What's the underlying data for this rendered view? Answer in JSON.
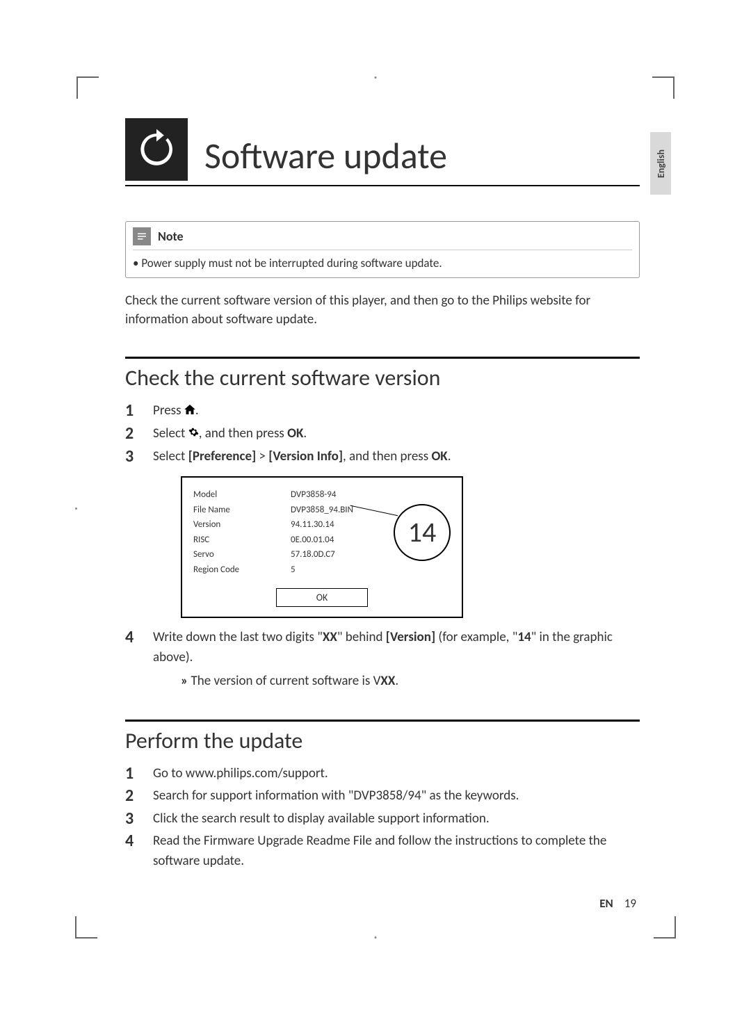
{
  "language_tab": "English",
  "title": "Software update",
  "note": {
    "label": "Note",
    "text": "Power supply must not be interrupted during software update."
  },
  "intro": "Check the current software version of this player, and then go to the Philips website for information about software update.",
  "section1": {
    "heading": "Check the current software version",
    "step1_prefix": "Press ",
    "step1_suffix": ".",
    "step2_prefix": "Select ",
    "step2_mid": ", and then press ",
    "step2_ok": "OK",
    "step2_suffix": ".",
    "step3_prefix": "Select ",
    "step3_pref": "[Preference]",
    "step3_gt": " > ",
    "step3_ver": "[Version Info]",
    "step3_mid": ", and then press ",
    "step3_ok": "OK",
    "step3_suffix": ".",
    "step4_prefix": "Write down the last two digits \"",
    "step4_xx": "XX",
    "step4_mid1": "\" behind ",
    "step4_version": "[Version]",
    "step4_mid2": " (for example, \"",
    "step4_14": "14",
    "step4_suffix": "\" in the graphic above).",
    "substep_prefix": "The version of current software is V",
    "substep_xx": "XX",
    "substep_suffix": "."
  },
  "diagram": {
    "rows": [
      {
        "label": "Model",
        "value": "DVP3858-94"
      },
      {
        "label": "File Name",
        "value": "DVP3858_94.BIN"
      },
      {
        "label": "Version",
        "value": "94.11.30.14"
      },
      {
        "label": "RISC",
        "value": "0E.00.01.04"
      },
      {
        "label": "Servo",
        "value": "57.18.0D.C7"
      },
      {
        "label": "Region Code",
        "value": "5"
      }
    ],
    "ok": "OK",
    "callout": "14"
  },
  "section2": {
    "heading": "Perform the update",
    "step1": "Go to www.philips.com/support.",
    "step2": "Search for support information with \"DVP3858/94\" as the keywords.",
    "step3": "Click the search result to display available support information.",
    "step4": "Read the Firmware Upgrade Readme File and follow the instructions to complete the software update."
  },
  "footer": {
    "lang": "EN",
    "page": "19"
  }
}
